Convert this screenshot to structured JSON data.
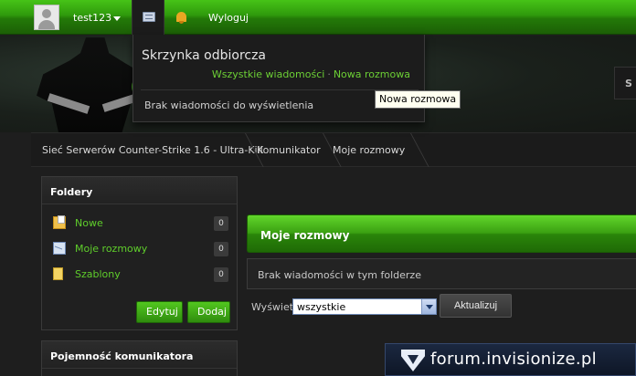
{
  "userbar": {
    "username": "test123",
    "logout_label": "Wyloguj"
  },
  "inbox_dropdown": {
    "title": "Skrzynka odbiorcza",
    "all_messages_link": "Wszystkie wiadomości",
    "separator": "·",
    "new_conversation_link": "Nowa rozmowa",
    "empty_text": "Brak wiadomości do wyświetlenia"
  },
  "tooltip": {
    "text": "Nowa rozmowa"
  },
  "header": {
    "search_stub_text": "S"
  },
  "breadcrumb": {
    "items": [
      "Sieć Serwerów Counter-Strike 1.6 - Ultra-Kill",
      "Komunikator",
      "Moje rozmowy"
    ]
  },
  "folders_panel": {
    "title": "Foldery",
    "items": [
      {
        "label": "Nowe",
        "count": "0",
        "icon": "new-folder-icon"
      },
      {
        "label": "Moje rozmowy",
        "count": "0",
        "icon": "envelope-icon"
      },
      {
        "label": "Szablony",
        "count": "0",
        "icon": "template-folder-icon"
      }
    ],
    "edit_button": "Edytuj",
    "add_button": "Dodaj"
  },
  "capacity_panel": {
    "title": "Pojemność komunikatora"
  },
  "main": {
    "title": "Moje rozmowy",
    "empty_text": "Brak wiadomości w tym folderze",
    "show_label": "Wyświetl",
    "filter_value": "wszystkie",
    "update_button": "Aktualizuj"
  },
  "watermark": {
    "text": "forum.invisionize.pl"
  },
  "colors": {
    "accent_green": "#3aa012",
    "link_green": "#5fce2b",
    "background": "#1e1e1e"
  }
}
